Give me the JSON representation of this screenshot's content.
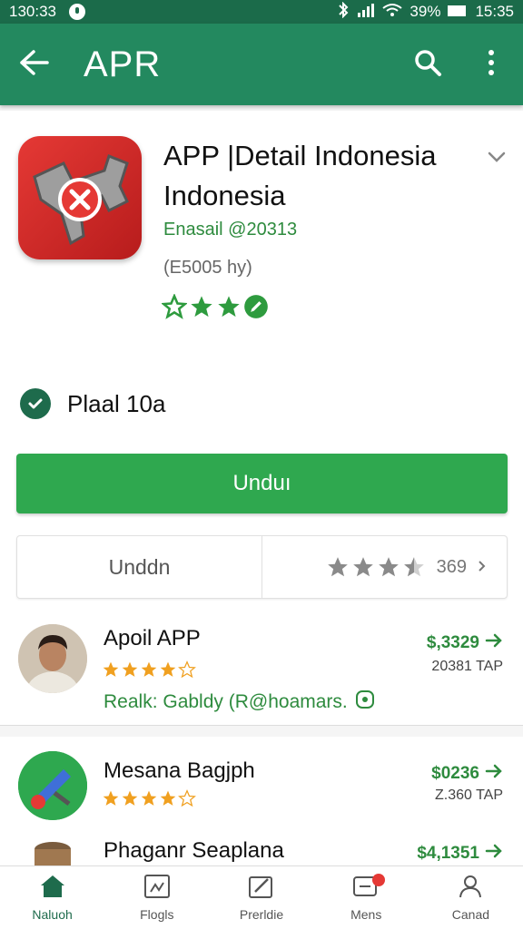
{
  "status_bar": {
    "time_left": "130:33",
    "battery": "39%",
    "time_right": "15:35"
  },
  "app_bar": {
    "title": "APR",
    "back_icon": "arrow-left-icon",
    "search_icon": "search-icon",
    "more_icon": "more-vert-icon"
  },
  "app": {
    "name": "APP |Detail Indonesia Indonesia",
    "developer": "Enasail @20313",
    "size": "(E5005 hy)",
    "rating_stars": 3.5
  },
  "status": {
    "label": "Plaal 10a"
  },
  "actions": {
    "install_label": "Unduı",
    "secondary_label": "Unddn",
    "review_count": "369"
  },
  "list": [
    {
      "title": "Apoil APP",
      "stars": 4,
      "link": "Realk: Gabldy  (R@hoamars.",
      "price": "$,3329",
      "sub": "20381 TAP"
    },
    {
      "title": "Mesana Bagjph",
      "stars": 4,
      "price": "$0236",
      "sub": "Z.360 TAP"
    },
    {
      "title": "Phaganr Seaplana",
      "price": "$4,1351"
    }
  ],
  "bottom_nav": [
    {
      "label": "Naluoh",
      "icon": "home-icon"
    },
    {
      "label": "Flogls",
      "icon": "apps-icon"
    },
    {
      "label": "Prerldie",
      "icon": "edit-icon"
    },
    {
      "label": "Mens",
      "icon": "notification-icon"
    },
    {
      "label": "Canad",
      "icon": "account-icon"
    }
  ],
  "colors": {
    "primary": "#23895f",
    "status_bar": "#1b6b4a",
    "install": "#2fa84f",
    "accent_text": "#2e8b3e",
    "star_gold": "#f0a020"
  }
}
